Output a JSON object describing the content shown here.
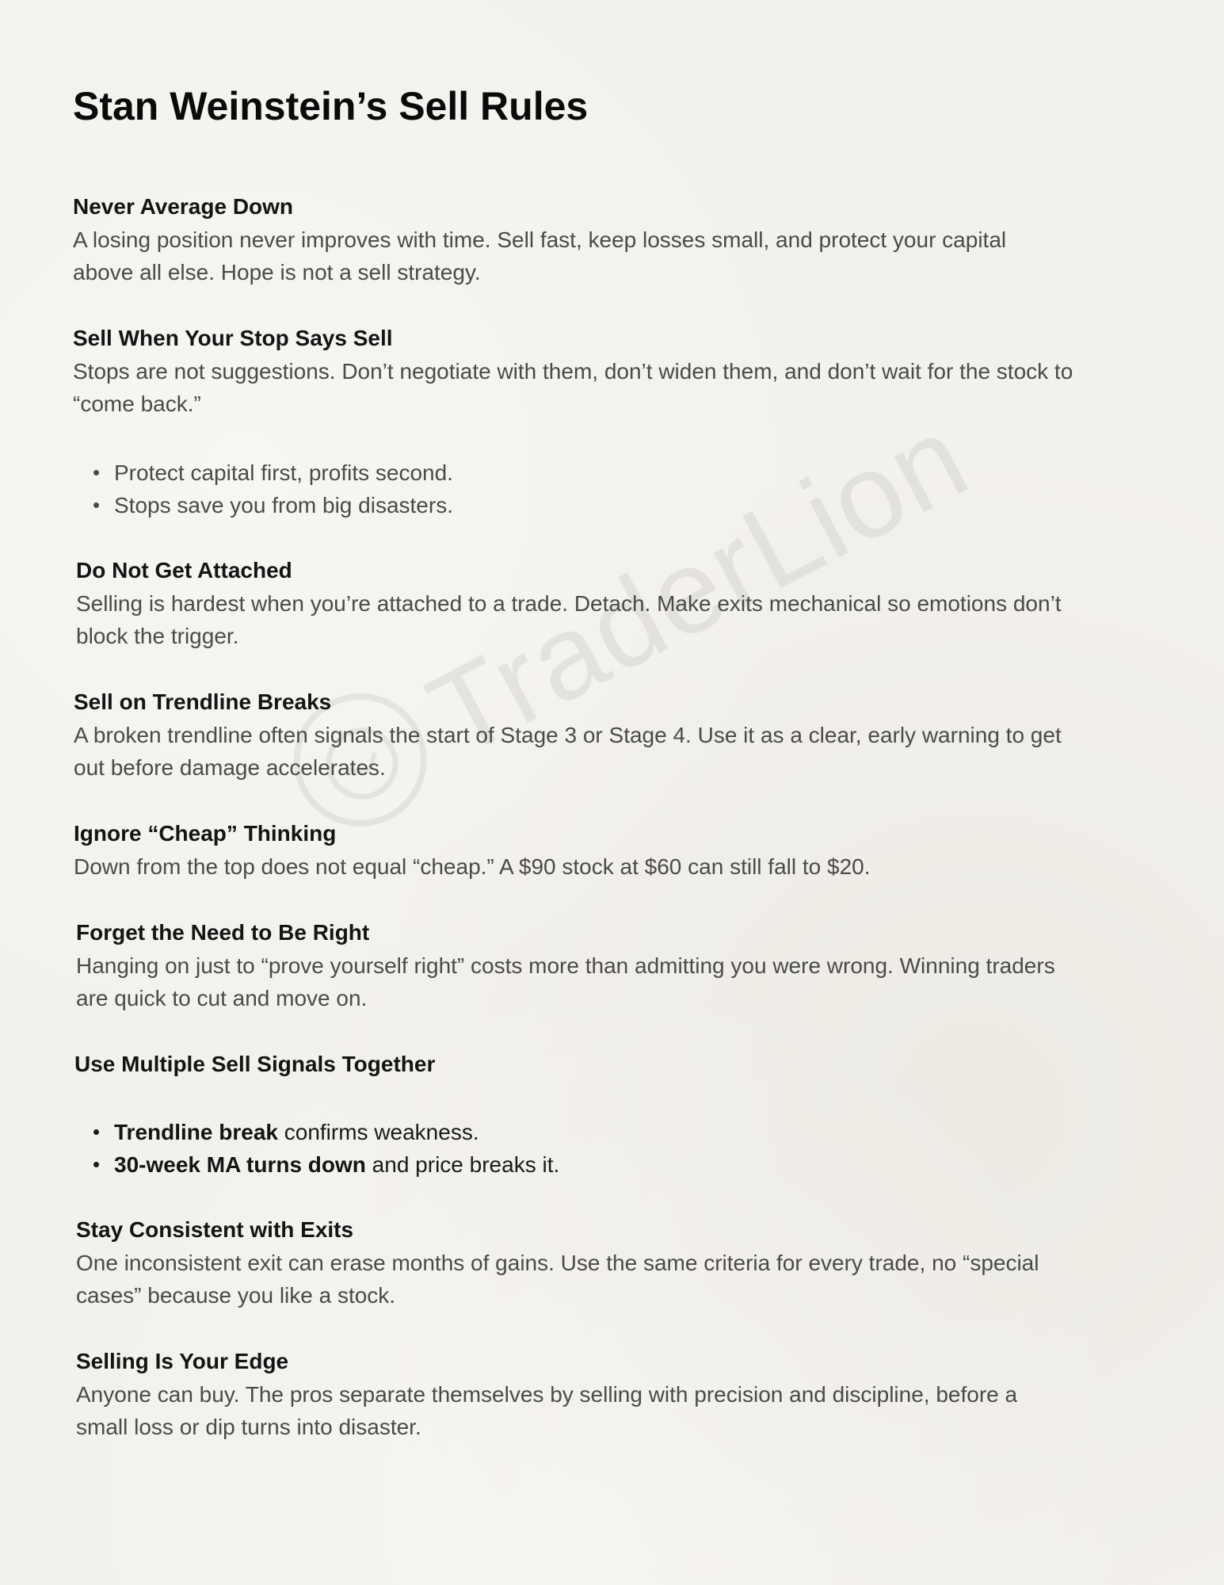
{
  "title": "Stan Weinstein’s Sell Rules",
  "watermark": {
    "text": "TraderLion",
    "icon": "lion-logo-icon"
  },
  "sections": [
    {
      "heading": "Never Average Down",
      "body_lines": [
        "A losing position never improves with time. Sell fast, keep losses small, and protect your capital",
        "above all else. Hope is not a sell strategy."
      ]
    },
    {
      "heading": "Sell When Your Stop Says Sell",
      "body_lines": [
        "Stops are not suggestions. Don’t negotiate with them, don’t widen them, and don’t wait for the stock to",
        "“come back.”"
      ],
      "bullets": [
        "Protect capital first, profits second.",
        "Stops save you from big disasters."
      ]
    },
    {
      "heading": "Do Not Get Attached",
      "body_lines": [
        "Selling is hardest when you’re attached to a trade. Detach. Make exits mechanical so emotions don’t",
        "block the trigger."
      ]
    },
    {
      "heading": "Sell on Trendline Breaks",
      "body_lines": [
        "A broken trendline often signals the start of Stage 3 or Stage 4. Use it as a clear, early warning to get",
        "out before damage accelerates."
      ]
    },
    {
      "heading": "Ignore “Cheap” Thinking",
      "body_lines": [
        "Down from the top does not equal “cheap.” A $90 stock at $60 can still fall to $20."
      ]
    },
    {
      "heading": "Forget the Need to Be Right",
      "body_lines": [
        "Hanging on just to “prove yourself right” costs more than admitting you were wrong. Winning traders",
        "are quick to cut and move on."
      ]
    },
    {
      "heading": "Use Multiple Sell Signals Together",
      "signal_bullets": [
        {
          "strong": "Trendline break",
          "rest": " confirms weakness."
        },
        {
          "strong": "30-week MA turns down",
          "rest": " and price breaks it."
        }
      ]
    },
    {
      "heading": "Stay Consistent with Exits",
      "body_lines": [
        "One inconsistent exit can erase months of gains. Use the same criteria for every trade, no “special",
        "cases” because you like a stock."
      ]
    },
    {
      "heading": "Selling Is Your Edge",
      "body_lines": [
        "Anyone can buy. The pros separate themselves by selling with precision and discipline, before a",
        "small loss or dip turns into disaster."
      ]
    }
  ]
}
